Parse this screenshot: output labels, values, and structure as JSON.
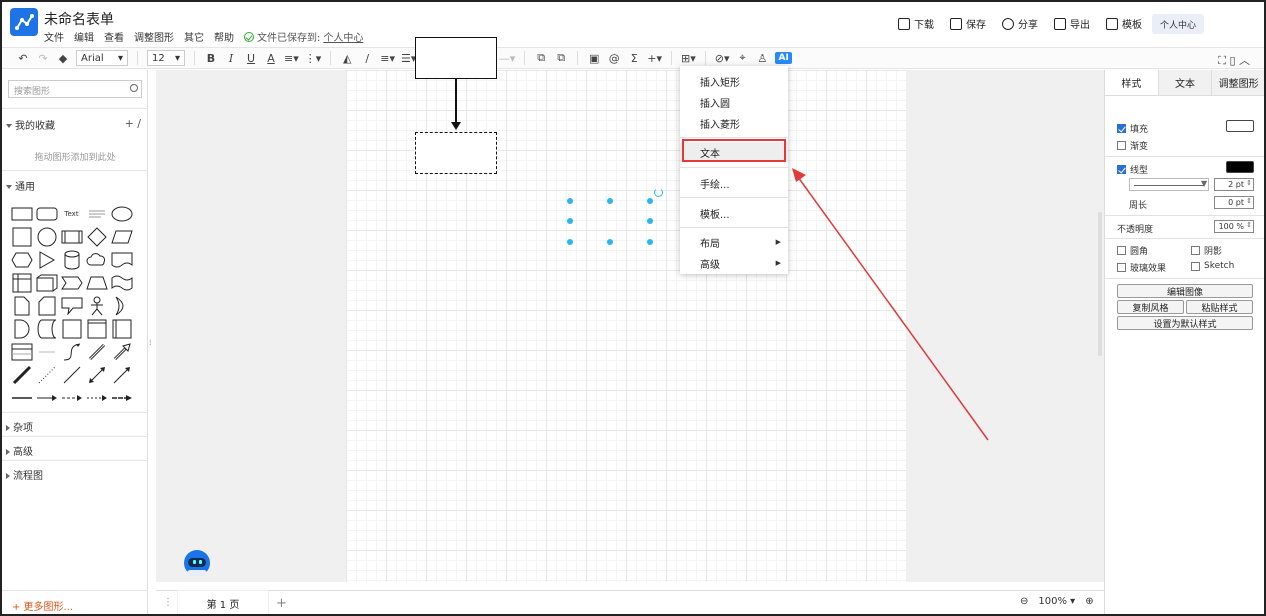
{
  "app": {
    "title": "未命名表单",
    "menu": [
      "文件",
      "编辑",
      "查看",
      "调整图形",
      "其它",
      "帮助"
    ],
    "saved_text": "文件已保存到:",
    "saved_location": "个人中心"
  },
  "header_actions": {
    "download": "下载",
    "save": "保存",
    "share": "分享",
    "export": "导出",
    "templates": "模板",
    "user_center": "个人中心"
  },
  "toolbar": {
    "font_family": "Arial",
    "font_size": "12",
    "bold": "B",
    "italic": "I",
    "underline": "U",
    "font_color": "A",
    "ai": "AI"
  },
  "left_panel": {
    "search_placeholder": "搜索图形",
    "favorites": "我的收藏",
    "favorites_hint": "拖动图形添加到此处",
    "general": "通用",
    "misc": "杂项",
    "advanced": "高级",
    "flowchart": "流程图",
    "more_shapes": "+ 更多图形...",
    "text_shape_label": "Text"
  },
  "context_menu": {
    "items": [
      {
        "label": "插入矩形"
      },
      {
        "label": "插入圆"
      },
      {
        "label": "插入菱形"
      },
      {
        "label": "文本"
      },
      {
        "label": "手绘..."
      },
      {
        "label": "模板..."
      },
      {
        "label": "布局",
        "submenu": true
      },
      {
        "label": "高级",
        "submenu": true
      }
    ]
  },
  "right_panel": {
    "tabs": [
      "样式",
      "文本",
      "调整图形"
    ],
    "fill": "填充",
    "gradient": "渐变",
    "line": "线型",
    "line_width": "2 pt",
    "perimeter": "周长",
    "perimeter_value": "0 pt",
    "opacity": "不透明度",
    "opacity_value": "100 %",
    "rounded": "圆角",
    "shadow": "阴影",
    "glass": "玻璃效果",
    "sketch": "Sketch",
    "edit_image": "编辑图像",
    "copy_style": "复制风格",
    "paste_style": "粘贴样式",
    "set_default_style": "设置为默认样式",
    "fill_color": "#ffffff",
    "line_color": "#000000"
  },
  "bottom": {
    "page_tab": "第 1 页",
    "zoom": "100%"
  },
  "colors": {
    "accent": "#1f74e5",
    "selection": "#29b6f2",
    "highlight": "#e23a3a",
    "more_shapes": "#e2561d"
  }
}
